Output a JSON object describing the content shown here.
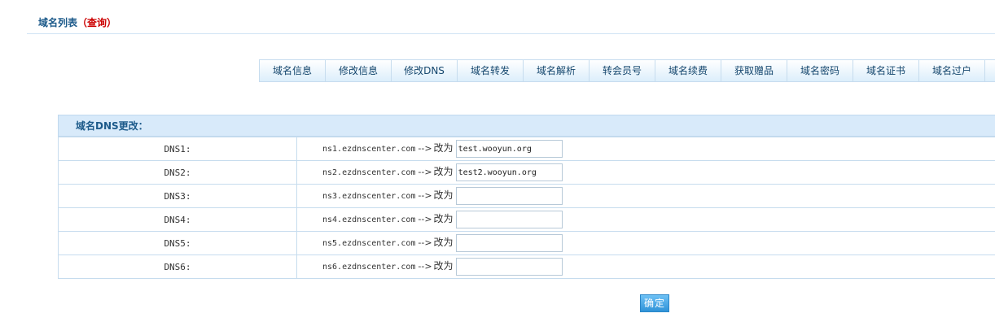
{
  "header": {
    "title": "域名列表",
    "subtitle": "（查询）"
  },
  "tabs": [
    {
      "label": "域名信息"
    },
    {
      "label": "修改信息"
    },
    {
      "label": "修改DNS"
    },
    {
      "label": "域名转发"
    },
    {
      "label": "域名解析"
    },
    {
      "label": "转会员号"
    },
    {
      "label": "域名续费"
    },
    {
      "label": "获取赠品"
    },
    {
      "label": "域名密码"
    },
    {
      "label": "域名证书"
    },
    {
      "label": "域名过户"
    }
  ],
  "dns_form": {
    "heading": "域名DNS更改：",
    "arrow": "-->",
    "change_label": "改为",
    "rows": [
      {
        "label": "DNS1:",
        "current": "ns1.ezdnscenter.com",
        "value": "test.wooyun.org"
      },
      {
        "label": "DNS2:",
        "current": "ns2.ezdnscenter.com",
        "value": "test2.wooyun.org"
      },
      {
        "label": "DNS3:",
        "current": "ns3.ezdnscenter.com",
        "value": ""
      },
      {
        "label": "DNS4:",
        "current": "ns4.ezdnscenter.com",
        "value": ""
      },
      {
        "label": "DNS5:",
        "current": "ns5.ezdnscenter.com",
        "value": ""
      },
      {
        "label": "DNS6:",
        "current": "ns6.ezdnscenter.com",
        "value": ""
      }
    ],
    "submit_label": "确定"
  }
}
